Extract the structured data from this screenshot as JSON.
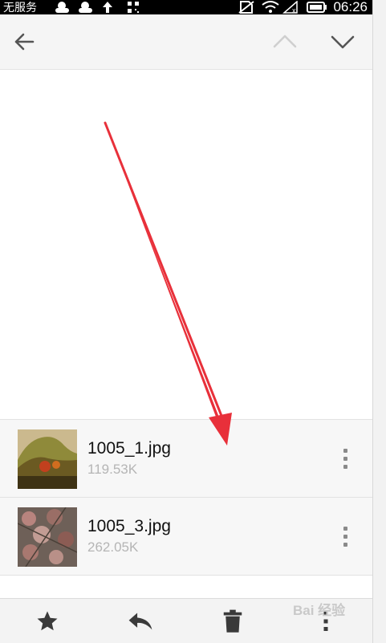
{
  "status_bar": {
    "carrier": "无服务",
    "time": "06:26",
    "icons": [
      "cloud-icon",
      "cloud-icon",
      "upload-arrow-icon",
      "qr-icon",
      "no-sim-icon",
      "wifi-icon",
      "signal-off-icon",
      "battery-icon"
    ]
  },
  "app_bar": {
    "back_icon": "arrow-left-icon",
    "prev_icon": "chevron-up-icon",
    "next_icon": "chevron-down-icon"
  },
  "attachments": [
    {
      "name": "1005_1.jpg",
      "size": "119.53K",
      "more_icon": "more-vert-icon"
    },
    {
      "name": "1005_3.jpg",
      "size": "262.05K",
      "more_icon": "more-vert-icon"
    }
  ],
  "toolbar": {
    "icons": [
      "star-icon",
      "reply-icon",
      "delete-icon",
      "more-vert-icon"
    ]
  },
  "watermark": {
    "text": "Bai 经验"
  },
  "colors": {
    "annotation_arrow": "#e8303a",
    "status_bar": "#000000",
    "app_bar": "#f5f5f5"
  }
}
